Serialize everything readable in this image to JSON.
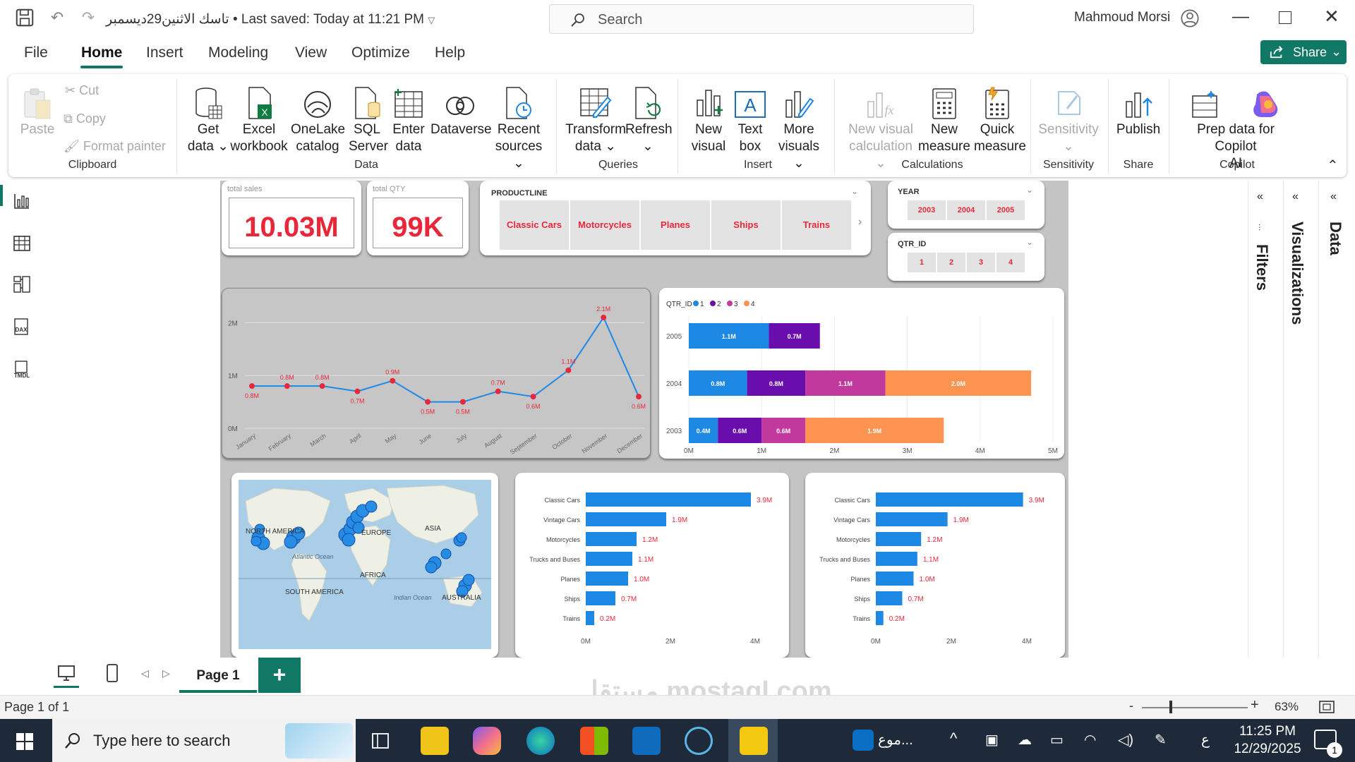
{
  "titlebar": {
    "doc_title": "تاسك الاثنين29ديسمبر • Last saved: Today at 11:21 PM",
    "search_placeholder": "Search",
    "user": "Mahmoud Morsi"
  },
  "menu": {
    "items": [
      "File",
      "Home",
      "Insert",
      "Modeling",
      "View",
      "Optimize",
      "Help"
    ],
    "share": "Share"
  },
  "ribbon": {
    "clipboard": {
      "paste": "Paste",
      "cut": "Cut",
      "copy": "Copy",
      "format_painter": "Format painter",
      "group": "Clipboard"
    },
    "data": {
      "get_data": "Get data",
      "excel": "Excel workbook",
      "onelake": "OneLake catalog",
      "sql": "SQL Server",
      "enter": "Enter data",
      "dataverse": "Dataverse",
      "recent": "Recent sources",
      "group": "Data"
    },
    "queries": {
      "transform": "Transform data",
      "refresh": "Refresh",
      "group": "Queries"
    },
    "insert": {
      "new_visual": "New visual",
      "text_box": "Text box",
      "more_visuals": "More visuals",
      "group": "Insert"
    },
    "calculations": {
      "new_visual_calc": "New visual calculation",
      "new_measure": "New measure",
      "quick_measure": "Quick measure",
      "group": "Calculations"
    },
    "sensitivity": {
      "label": "Sensitivity",
      "group": "Sensitivity"
    },
    "share": {
      "publish": "Publish",
      "group": "Share"
    },
    "copilot": {
      "prep": "Prep data for Copilot",
      "ai": "AI",
      "group": "Copilot"
    }
  },
  "report": {
    "kpi_sales": {
      "title": "total sales",
      "value": "10.03M"
    },
    "kpi_qty": {
      "title": "total QTY",
      "value": "99K"
    },
    "productline": {
      "title": "PRODUCTLINE",
      "items": [
        "Classic Cars",
        "Motorcycles",
        "Planes",
        "Ships",
        "Trains"
      ]
    },
    "year": {
      "title": "YEAR",
      "items": [
        "2003",
        "2004",
        "2005"
      ]
    },
    "qtr": {
      "title": "QTR_ID",
      "items": [
        "1",
        "2",
        "3",
        "4"
      ]
    },
    "map": {
      "labels": [
        "NORTH AMERICA",
        "EUROPE",
        "ASIA",
        "Atlantic Ocean",
        "AFRICA",
        "SOUTH AMERICA",
        "Indian Ocean",
        "AUSTRALIA"
      ]
    }
  },
  "chart_data": [
    {
      "type": "line",
      "x": [
        "January",
        "February",
        "March",
        "April",
        "May",
        "June",
        "July",
        "August",
        "September",
        "October",
        "November",
        "December"
      ],
      "values": [
        0.8,
        0.8,
        0.8,
        0.7,
        0.9,
        0.5,
        0.5,
        0.7,
        0.6,
        1.1,
        2.1,
        0.6
      ],
      "data_labels": [
        "0.8M",
        "0.8M",
        "0.8M",
        "0.7M",
        "0.9M",
        "0.5M",
        "0.5M",
        "0.7M",
        "0.6M",
        "1.1M",
        "2.1M",
        "0.6M"
      ],
      "y_ticks": [
        "0M",
        "1M",
        "2M"
      ],
      "ylim": [
        0,
        2.3
      ],
      "color": "#1e88e5",
      "marker_color": "#e8283a"
    },
    {
      "type": "bar",
      "orientation": "horizontal-stacked",
      "legend_title": "QTR_ID",
      "legend": [
        "1",
        "2",
        "3",
        "4"
      ],
      "colors": [
        "#1e88e5",
        "#6a0dad",
        "#c2399e",
        "#fd9350"
      ],
      "categories": [
        "2005",
        "2004",
        "2003"
      ],
      "series": [
        {
          "name": "1",
          "values": [
            1.1,
            0.8,
            0.4
          ],
          "labels": [
            "1.1M",
            "0.8M",
            "0.4M"
          ]
        },
        {
          "name": "2",
          "values": [
            0.7,
            0.8,
            0.6
          ],
          "labels": [
            "0.7M",
            "0.8M",
            "0.6M"
          ]
        },
        {
          "name": "3",
          "values": [
            0,
            1.1,
            0.6
          ],
          "labels": [
            "",
            "1.1M",
            "0.6M"
          ]
        },
        {
          "name": "4",
          "values": [
            0,
            2.0,
            1.9
          ],
          "labels": [
            "",
            "2.0M",
            "1.9M"
          ]
        }
      ],
      "x_ticks": [
        "0M",
        "1M",
        "2M",
        "3M",
        "4M",
        "5M"
      ],
      "xlim": [
        0,
        5
      ]
    },
    {
      "type": "bar",
      "orientation": "horizontal",
      "categories": [
        "Classic Cars",
        "Vintage Cars",
        "Motorcycles",
        "Trucks and Buses",
        "Planes",
        "Ships",
        "Trains"
      ],
      "values": [
        3.9,
        1.9,
        1.2,
        1.1,
        1.0,
        0.7,
        0.2
      ],
      "labels": [
        "3.9M",
        "1.9M",
        "1.2M",
        "1.1M",
        "1.0M",
        "0.7M",
        "0.2M"
      ],
      "x_ticks": [
        "0M",
        "2M",
        "4M"
      ],
      "xlim": [
        0,
        4
      ],
      "color": "#1e88e5"
    },
    {
      "type": "bar",
      "orientation": "horizontal",
      "categories": [
        "Classic Cars",
        "Vintage Cars",
        "Motorcycles",
        "Trucks and Buses",
        "Planes",
        "Ships",
        "Trains"
      ],
      "values": [
        3.9,
        1.9,
        1.2,
        1.1,
        1.0,
        0.7,
        0.2
      ],
      "labels": [
        "3.9M",
        "1.9M",
        "1.2M",
        "1.1M",
        "1.0M",
        "0.7M",
        "0.2M"
      ],
      "x_ticks": [
        "0M",
        "2M",
        "4M"
      ],
      "xlim": [
        0,
        4
      ],
      "color": "#1e88e5"
    }
  ],
  "panes": {
    "filters": "Filters",
    "visualizations": "Visualizations",
    "data": "Data"
  },
  "pages": {
    "tab": "Page 1",
    "add": "+",
    "status": "Page 1 of 1",
    "zoom": "63%"
  },
  "taskbar": {
    "search": "Type here to search",
    "app_label": "موع...",
    "lang": "ع",
    "time": "11:25 PM",
    "date": "12/29/2025",
    "notif": "1"
  },
  "watermark": "مستقل mostaql.com"
}
